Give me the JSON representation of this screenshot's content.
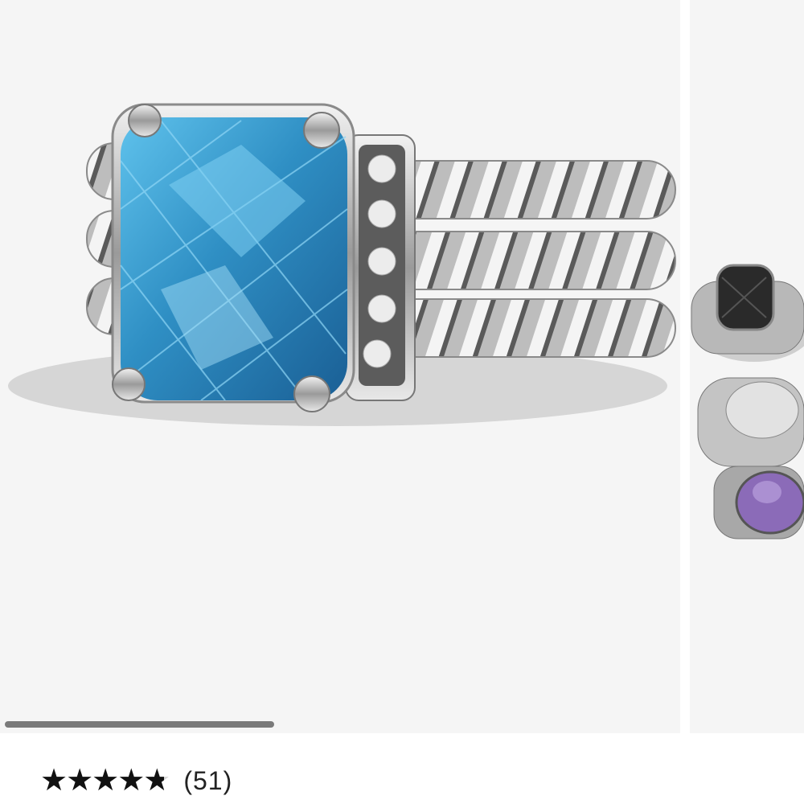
{
  "gallery": {
    "main_image": "blue-topaz-ring-photo",
    "next_image": "assorted-rings-photo",
    "scroll_progress": 0.58
  },
  "rating": {
    "stars_text": "★★★★★",
    "score": 4.8,
    "max": 5,
    "count_label": "(51)"
  },
  "colors": {
    "panel_bg": "#f5f5f5",
    "gem_blue": "#2f8fc4",
    "star": "#111111"
  }
}
